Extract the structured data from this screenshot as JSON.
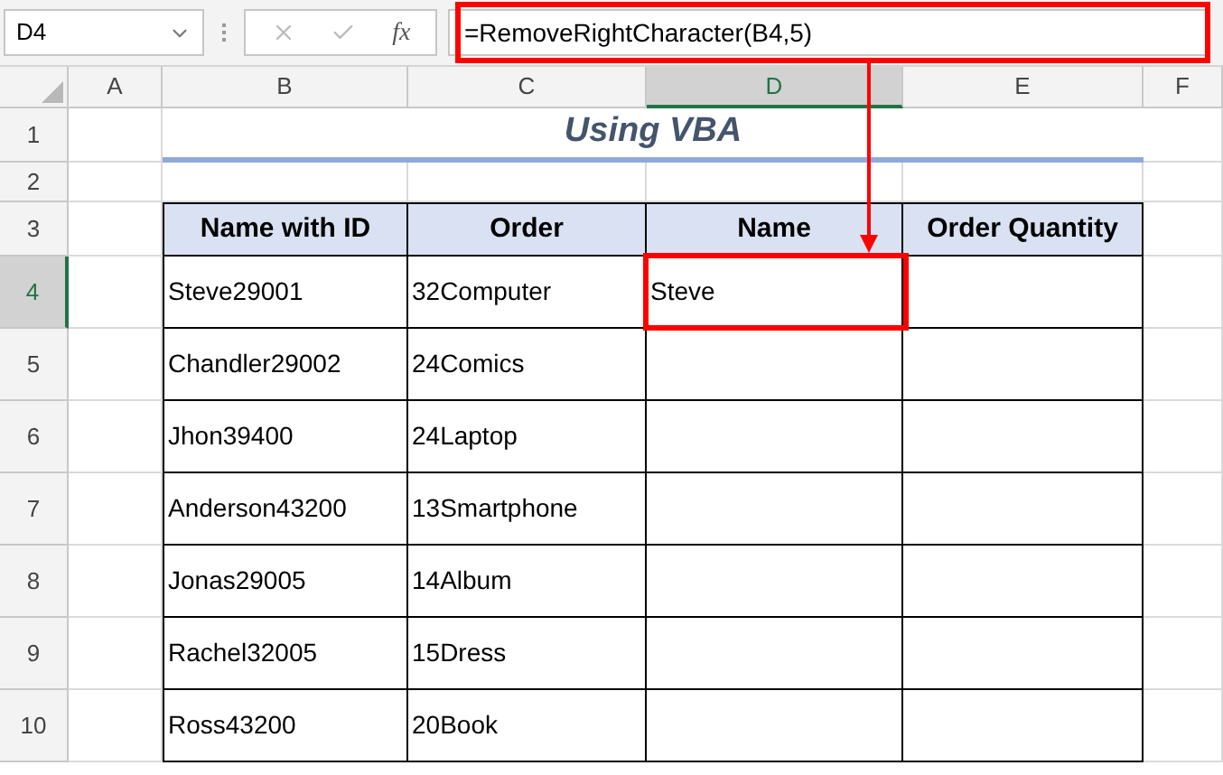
{
  "name_box": {
    "value": "D4"
  },
  "formula_bar": {
    "function_label": "fx",
    "formula": "=RemoveRightCharacter(B4,5)"
  },
  "columns": [
    {
      "label": "A",
      "selected": false
    },
    {
      "label": "B",
      "selected": false
    },
    {
      "label": "C",
      "selected": false
    },
    {
      "label": "D",
      "selected": true
    },
    {
      "label": "E",
      "selected": false
    },
    {
      "label": "F",
      "selected": false
    }
  ],
  "rows": [
    {
      "label": "1",
      "selected": false
    },
    {
      "label": "2",
      "selected": false
    },
    {
      "label": "3",
      "selected": false
    },
    {
      "label": "4",
      "selected": true
    },
    {
      "label": "5",
      "selected": false
    },
    {
      "label": "6",
      "selected": false
    },
    {
      "label": "7",
      "selected": false
    },
    {
      "label": "8",
      "selected": false
    },
    {
      "label": "9",
      "selected": false
    },
    {
      "label": "10",
      "selected": false
    }
  ],
  "title": "Using VBA",
  "table": {
    "columns": [
      "Name with ID",
      "Order",
      "Name",
      "Order Quantity"
    ],
    "rows": [
      {
        "cells": [
          "Steve29001",
          "32Computer",
          "Steve"
        ]
      },
      {
        "cells": [
          "Chandler29002",
          "24Comics"
        ]
      },
      {
        "cells": [
          "Jhon39400",
          "24Laptop"
        ]
      },
      {
        "cells": [
          "Anderson43200",
          "13Smartphone"
        ]
      },
      {
        "cells": [
          "Jonas29005",
          "14Album"
        ]
      },
      {
        "cells": [
          "Rachel32005",
          "15Dress"
        ]
      },
      {
        "cells": [
          "Ross43200",
          "20Book"
        ]
      }
    ]
  }
}
